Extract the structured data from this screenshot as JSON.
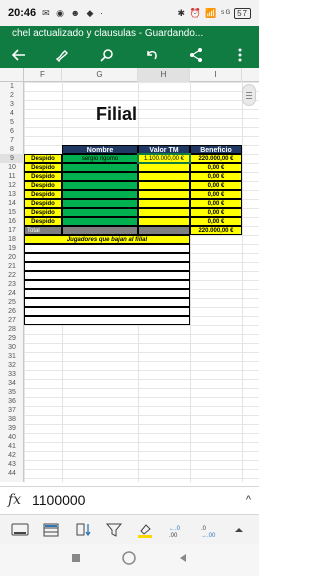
{
  "status": {
    "time": "20:46",
    "left_icons": "✉ ◉ ☻ ◆ ·",
    "right_icons": "✱ ⏰ 📶 ⁵ᴳ",
    "battery": "57"
  },
  "app": {
    "title": "chel actualizado y clausulas - Guardando..."
  },
  "columns": [
    {
      "label": "F",
      "selected": false
    },
    {
      "label": "G",
      "selected": false
    },
    {
      "label": "H",
      "selected": true
    },
    {
      "label": "I",
      "selected": false
    }
  ],
  "rows": [
    "1",
    "2",
    "3",
    "4",
    "5",
    "6",
    "7",
    "8",
    "9",
    "10",
    "11",
    "12",
    "13",
    "14",
    "15",
    "16",
    "17",
    "18",
    "19",
    "20",
    "21",
    "22",
    "23",
    "24",
    "25",
    "26",
    "27",
    "28",
    "29",
    "30",
    "31",
    "32",
    "33",
    "34",
    "35",
    "36",
    "37",
    "38",
    "39",
    "40",
    "41",
    "42",
    "43",
    "44"
  ],
  "selected_row": "9",
  "sheet": {
    "title": "Filial",
    "headers": {
      "nombre": "Nombre",
      "valor": "Valor TM",
      "beneficio": "Beneficio"
    },
    "despido_label": "Despido",
    "data_rows": [
      {
        "name": "sergio rigomo",
        "valor": "1.100.000,00 €",
        "beneficio": "220.000,00 €"
      },
      {
        "name": "",
        "valor": "",
        "beneficio": "0,00 €"
      },
      {
        "name": "",
        "valor": "",
        "beneficio": "0,00 €"
      },
      {
        "name": "",
        "valor": "",
        "beneficio": "0,00 €"
      },
      {
        "name": "",
        "valor": "",
        "beneficio": "0,00 €"
      },
      {
        "name": "",
        "valor": "",
        "beneficio": "0,00 €"
      },
      {
        "name": "",
        "valor": "",
        "beneficio": "0,00 €"
      },
      {
        "name": "",
        "valor": "",
        "beneficio": "0,00 €"
      }
    ],
    "total_label": "Total",
    "total_beneficio": "220.000,00 €",
    "jugadores_label": "Jugadores que bajan al filial"
  },
  "formula": {
    "fx": "fx",
    "value": "1100000"
  },
  "colors": {
    "excel_green": "#107c41",
    "header_navy": "#1f3864",
    "yellow": "#ffff00",
    "green_cell": "#00b050",
    "gray_total": "#808080"
  }
}
